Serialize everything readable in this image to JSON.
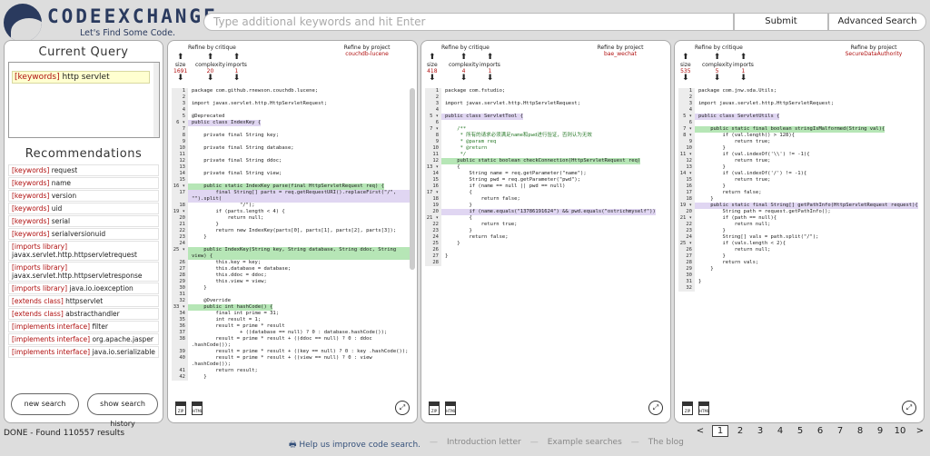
{
  "header": {
    "logo_title": "CODEEXCHANGE",
    "logo_tagline": "Let's Find Some Code.",
    "search_placeholder": "Type additional keywords and hit Enter",
    "submit_label": "Submit",
    "advanced_label": "Advanced Search"
  },
  "left": {
    "current_query_title": "Current Query",
    "query_token": {
      "kind": "[keywords]",
      "text": "http servlet"
    },
    "recommendations_title": "Recommendations",
    "recommendations": [
      {
        "kind": "[keywords]",
        "text": "request"
      },
      {
        "kind": "[keywords]",
        "text": "name"
      },
      {
        "kind": "[keywords]",
        "text": "version"
      },
      {
        "kind": "[keywords]",
        "text": "uid"
      },
      {
        "kind": "[keywords]",
        "text": "serial"
      },
      {
        "kind": "[keywords]",
        "text": "serialversionuid"
      },
      {
        "kind": "[imports library]",
        "text": "javax.servlet.http.httpservletrequest"
      },
      {
        "kind": "[imports library]",
        "text": "javax.servlet.http.httpservletresponse"
      },
      {
        "kind": "[imports library]",
        "text": "java.io.ioexception"
      },
      {
        "kind": "[extends class]",
        "text": "httpservlet"
      },
      {
        "kind": "[extends class]",
        "text": "abstracthandler"
      },
      {
        "kind": "[implements interface]",
        "text": "filter"
      },
      {
        "kind": "[implements interface]",
        "text": "org.apache.jasper"
      },
      {
        "kind": "[implements interface]",
        "text": "java.io.serializable"
      }
    ],
    "new_search_label": "new search",
    "history_label": "show search history"
  },
  "results": [
    {
      "refine_critique": "Refine by critique",
      "refine_project": "Refine by project",
      "project": "couchdb-lucene",
      "size_label": "size",
      "size": "1691",
      "complexity_label": "complexity",
      "complexity": "20",
      "imports_label": "imports",
      "imports": "1",
      "lines": [
        {
          "n": "1",
          "t": "package com.github.rnewson.couchdb.lucene;"
        },
        {
          "n": "2",
          "t": ""
        },
        {
          "n": "3",
          "t": "import javax.servlet.http.HttpServletRequest;"
        },
        {
          "n": "4",
          "t": ""
        },
        {
          "n": "5",
          "t": "@Deprecated"
        },
        {
          "n": "6 ▾",
          "t": "public class IndexKey {",
          "hl": "purple"
        },
        {
          "n": "7",
          "t": ""
        },
        {
          "n": "8",
          "t": "    private final String key;"
        },
        {
          "n": "9",
          "t": ""
        },
        {
          "n": "10",
          "t": "    private final String database;"
        },
        {
          "n": "11",
          "t": ""
        },
        {
          "n": "12",
          "t": "    private final String ddoc;"
        },
        {
          "n": "13",
          "t": ""
        },
        {
          "n": "14",
          "t": "    private final String view;"
        },
        {
          "n": "15",
          "t": ""
        },
        {
          "n": "16 ▾",
          "t": "    public static IndexKey parse(final HttpServletRequest req) {",
          "hl": "green"
        },
        {
          "n": "17",
          "t": "        final String[] parts = req.getRequestURI().replaceFirst(\"/\", \"\").split(",
          "hl": "purple"
        },
        {
          "n": "18",
          "t": "                \"/\");"
        },
        {
          "n": "19 ▾",
          "t": "        if (parts.length < 4) {"
        },
        {
          "n": "20",
          "t": "            return null;"
        },
        {
          "n": "21",
          "t": "        }"
        },
        {
          "n": "22",
          "t": "        return new IndexKey(parts[0], parts[1], parts[2], parts[3]);"
        },
        {
          "n": "23",
          "t": "    }"
        },
        {
          "n": "24",
          "t": ""
        },
        {
          "n": "25 ▾",
          "t": "    public IndexKey(String key, String database, String ddoc, String view) {",
          "hl": "green"
        },
        {
          "n": "26",
          "t": "        this.key = key;"
        },
        {
          "n": "27",
          "t": "        this.database = database;"
        },
        {
          "n": "28",
          "t": "        this.ddoc = ddoc;"
        },
        {
          "n": "29",
          "t": "        this.view = view;"
        },
        {
          "n": "30",
          "t": "    }"
        },
        {
          "n": "31",
          "t": ""
        },
        {
          "n": "32",
          "t": "    @Override"
        },
        {
          "n": "33 ▾",
          "t": "    public int hashCode() {",
          "hl": "green"
        },
        {
          "n": "34",
          "t": "        final int prime = 31;"
        },
        {
          "n": "35",
          "t": "        int result = 1;"
        },
        {
          "n": "36",
          "t": "        result = prime * result"
        },
        {
          "n": "37",
          "t": "                + ((database == null) ? 0 : database.hashCode());"
        },
        {
          "n": "38",
          "t": "        result = prime * result + ((ddoc == null) ? 0 : ddoc .hashCode());"
        },
        {
          "n": "39",
          "t": "        result = prime * result + ((key == null) ? 0 : key .hashCode());"
        },
        {
          "n": "40",
          "t": "        result = prime * result + ((view == null) ? 0 : view .hashCode());"
        },
        {
          "n": "41",
          "t": "        return result;"
        },
        {
          "n": "42",
          "t": "    }"
        }
      ]
    },
    {
      "refine_critique": "Refine by critique",
      "refine_project": "Refine by project",
      "project": "bae_wechat",
      "size_label": "size",
      "size": "418",
      "complexity_label": "complexity",
      "complexity": "4",
      "imports_label": "imports",
      "imports": "1",
      "lines": [
        {
          "n": "1",
          "t": "package com.fstudio;"
        },
        {
          "n": "2",
          "t": ""
        },
        {
          "n": "3",
          "t": "import javax.servlet.http.HttpServletRequest;"
        },
        {
          "n": "4",
          "t": ""
        },
        {
          "n": "5 ▾",
          "t": "public class ServletTool {",
          "hl": "purple"
        },
        {
          "n": "6",
          "t": ""
        },
        {
          "n": "7 ▾",
          "t": "    /**",
          "c": true
        },
        {
          "n": "8",
          "t": "     * 所有的请求必须满足name和pwd进行验证，否则认为无效",
          "c": true
        },
        {
          "n": "9",
          "t": "     * @param req",
          "c": true
        },
        {
          "n": "10",
          "t": "     * @return",
          "c": true
        },
        {
          "n": "11",
          "t": "     */",
          "c": true
        },
        {
          "n": "12",
          "t": "    public static boolean checkConnection(HttpServletRequest req)",
          "hl": "green"
        },
        {
          "n": "13 ▾",
          "t": "    {"
        },
        {
          "n": "14",
          "t": "        String name = req.getParameter(\"name\");"
        },
        {
          "n": "15",
          "t": "        String pwd = req.getParameter(\"pwd\");"
        },
        {
          "n": "16",
          "t": "        if (name == null || pwd == null)"
        },
        {
          "n": "17 ▾",
          "t": "        {"
        },
        {
          "n": "18",
          "t": "            return false;"
        },
        {
          "n": "19",
          "t": "        }"
        },
        {
          "n": "20",
          "t": "        if (name.equals(\"13786191624\") && pwd.equals(\"ostrichmyself\"))",
          "hl": "purple"
        },
        {
          "n": "21 ▾",
          "t": "        {"
        },
        {
          "n": "22",
          "t": "            return true;"
        },
        {
          "n": "23",
          "t": "        }"
        },
        {
          "n": "24",
          "t": "        return false;"
        },
        {
          "n": "25",
          "t": "    }"
        },
        {
          "n": "26",
          "t": ""
        },
        {
          "n": "27",
          "t": "}"
        },
        {
          "n": "28",
          "t": ""
        }
      ]
    },
    {
      "refine_critique": "Refine by critique",
      "refine_project": "Refine by project",
      "project": "SecureDataAuthority",
      "size_label": "size",
      "size": "535",
      "complexity_label": "complexity",
      "complexity": "5",
      "imports_label": "imports",
      "imports": "1",
      "lines": [
        {
          "n": "1",
          "t": "package com.jnw.sda.Utils;"
        },
        {
          "n": "2",
          "t": ""
        },
        {
          "n": "3",
          "t": "import javax.servlet.http.HttpServletRequest;"
        },
        {
          "n": "4",
          "t": ""
        },
        {
          "n": "5 ▾",
          "t": "public class ServletUtils {",
          "hl": "purple"
        },
        {
          "n": "6",
          "t": ""
        },
        {
          "n": "7 ▾",
          "t": "    public static final boolean stringIsMalformed(String val){",
          "hl": "green"
        },
        {
          "n": "8 ▾",
          "t": "        if (val.length() > 128){"
        },
        {
          "n": "9",
          "t": "            return true;"
        },
        {
          "n": "10",
          "t": "        }"
        },
        {
          "n": "11 ▾",
          "t": "        if (val.indexOf('\\\\') != -1){"
        },
        {
          "n": "12",
          "t": "            return true;"
        },
        {
          "n": "13",
          "t": "        }"
        },
        {
          "n": "14 ▾",
          "t": "        if (val.indexOf('/') != -1){"
        },
        {
          "n": "15",
          "t": "            return true;"
        },
        {
          "n": "16",
          "t": "        }"
        },
        {
          "n": "17",
          "t": "        return false;"
        },
        {
          "n": "18",
          "t": "    }"
        },
        {
          "n": "19 ▾",
          "t": "    public static final String[] getPathInfo(HttpServletRequest request){",
          "hl": "purple"
        },
        {
          "n": "20",
          "t": "        String path = request.getPathInfo();"
        },
        {
          "n": "21 ▾",
          "t": "        if (path == null){"
        },
        {
          "n": "22",
          "t": "            return null;"
        },
        {
          "n": "23",
          "t": "        }"
        },
        {
          "n": "24",
          "t": "        String[] vals = path.split(\"/\");"
        },
        {
          "n": "25 ▾",
          "t": "        if (vals.length < 2){"
        },
        {
          "n": "26",
          "t": "            return null;"
        },
        {
          "n": "27",
          "t": "        }"
        },
        {
          "n": "28",
          "t": "        return vals;"
        },
        {
          "n": "29",
          "t": "    }"
        },
        {
          "n": "30",
          "t": ""
        },
        {
          "n": "31",
          "t": "}"
        },
        {
          "n": "32",
          "t": ""
        }
      ]
    }
  ],
  "status": "DONE - Found 110557 results",
  "pager": {
    "prev": "<",
    "next": ">",
    "current": "1",
    "pages": [
      "1",
      "2",
      "3",
      "4",
      "5",
      "6",
      "7",
      "8",
      "9",
      "10"
    ]
  },
  "footer": {
    "help_link": "Help us improve code search.",
    "intro_link": "Introduction letter",
    "examples_link": "Example searches",
    "blog_link": "The blog",
    "separator": "—"
  },
  "icons": {
    "zip": "ZIP",
    "html": "HTML"
  }
}
